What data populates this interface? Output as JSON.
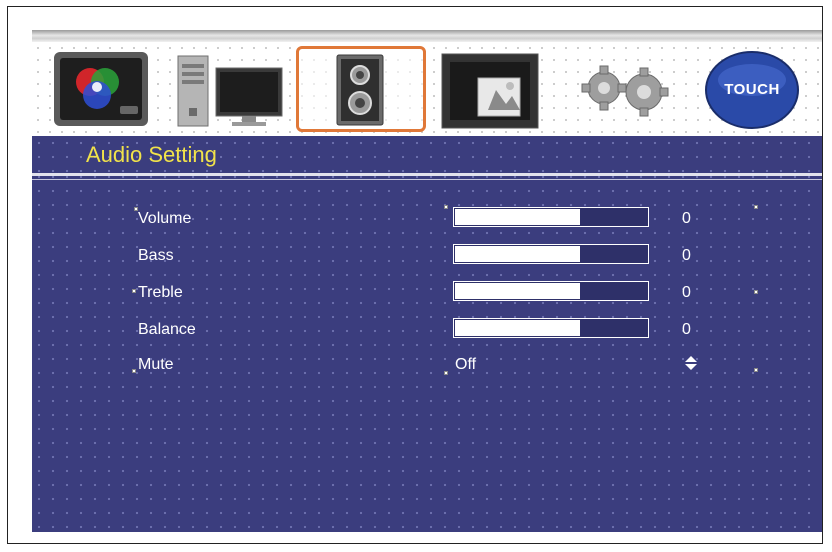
{
  "menu": {
    "tabs": [
      {
        "name": "color-tab",
        "icon": "tv-color-wheel-icon"
      },
      {
        "name": "pc-tab",
        "icon": "desktop-computer-icon"
      },
      {
        "name": "audio-tab",
        "icon": "speaker-icon",
        "selected": true
      },
      {
        "name": "picture-tab",
        "icon": "picture-frame-icon"
      },
      {
        "name": "setup-tab",
        "icon": "gears-icon"
      },
      {
        "name": "touch-tab",
        "icon": "touch-button-icon",
        "label": "TOUCH"
      }
    ],
    "title": "Audio Setting"
  },
  "audio": {
    "volume": {
      "label": "Volume",
      "value": "0",
      "level": 0.66
    },
    "bass": {
      "label": "Bass",
      "value": "0",
      "level": 0.66
    },
    "treble": {
      "label": "Treble",
      "value": "0",
      "level": 0.66
    },
    "balance": {
      "label": "Balance",
      "value": "0",
      "level": 0.66
    },
    "mute": {
      "label": "Mute",
      "value": "Off",
      "icon": "up-down-arrow-icon"
    }
  },
  "colors": {
    "panel_bg": "#3b3d7e",
    "title_text": "#f1e24a",
    "selection_border": "#e07838",
    "touch_button": "#2a4aa8"
  }
}
